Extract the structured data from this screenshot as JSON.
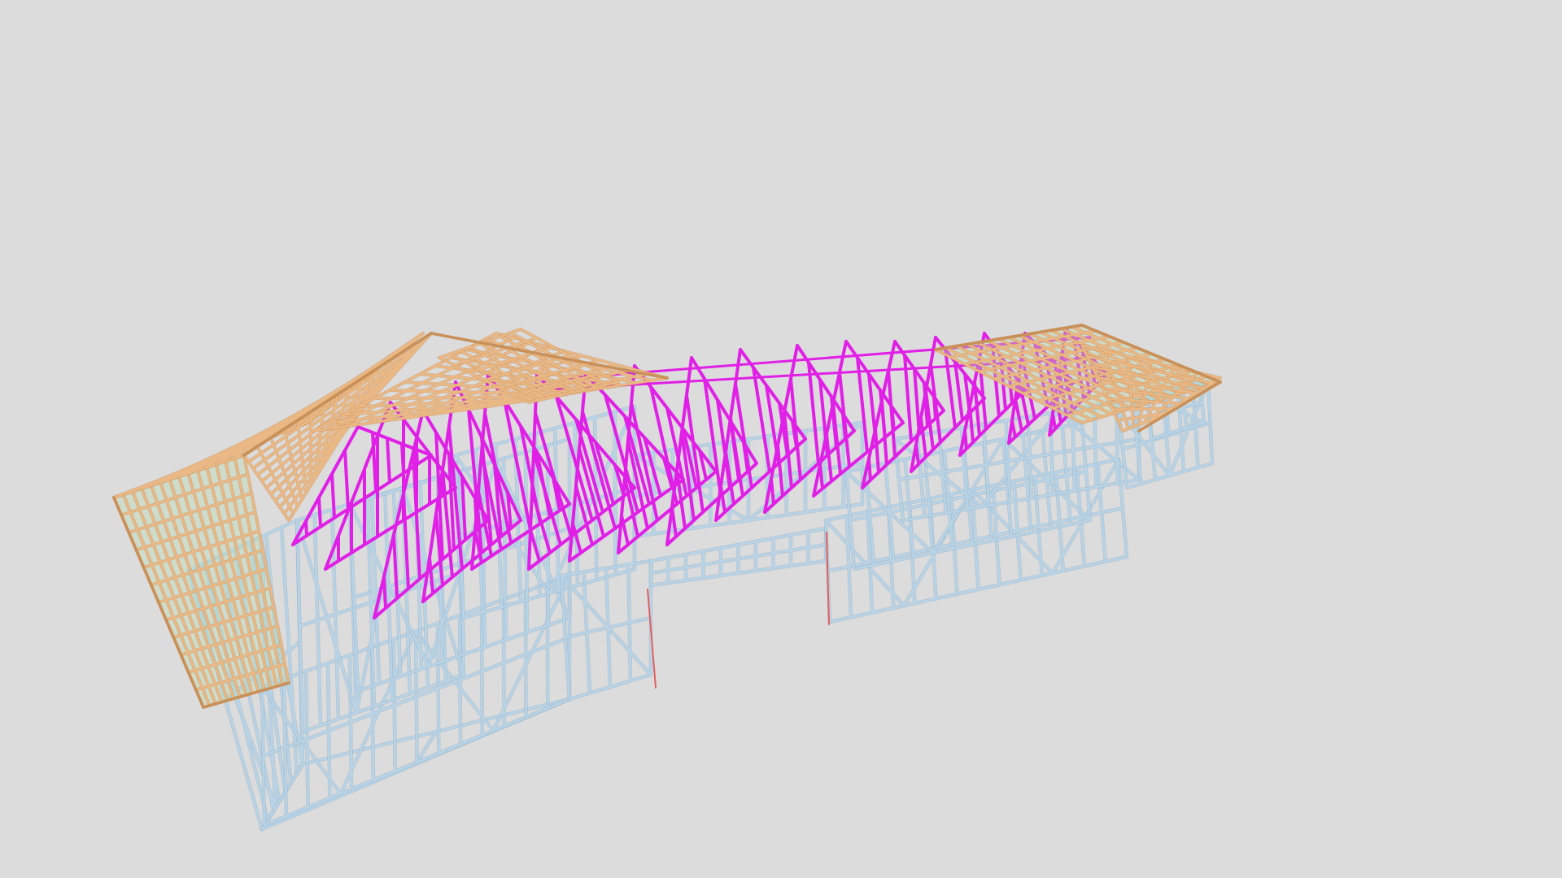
{
  "viewer": {
    "background": "#dcdcdc",
    "scene": "3d-roof-truss-wall-frame-model"
  },
  "colors": {
    "wall_frame": "#b9d3e6",
    "wall_frame_shadow": "#8fb0c9",
    "truss": "#e020e6",
    "roof_batten": "#eab884",
    "roof_batten_dark": "#c99058",
    "insulation": "#b7dcae",
    "red_edge": "#e06060"
  }
}
